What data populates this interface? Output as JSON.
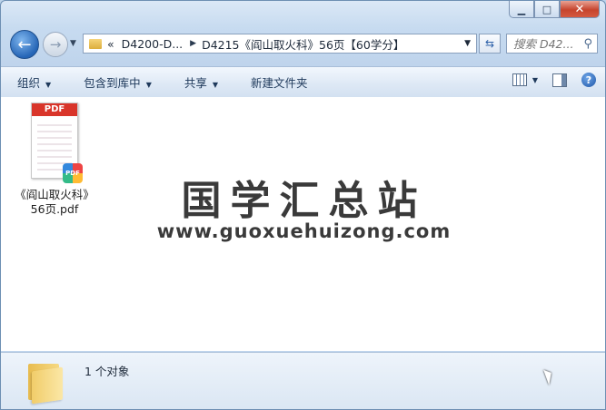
{
  "window": {
    "caption": {
      "minimize": "▁",
      "maximize": "□",
      "close": "✕"
    }
  },
  "nav": {
    "back_icon": "left-arrow-icon",
    "forward_icon": "right-arrow-icon",
    "breadcrumb": [
      {
        "label": "«"
      },
      {
        "label": "D4200-D..."
      },
      {
        "label": "D4215《阎山取火科》56页【60学分】"
      }
    ],
    "search_placeholder": "搜索 D42..."
  },
  "toolbar": {
    "organize": "组织",
    "include_library": "包含到库中",
    "share": "共享",
    "new_folder": "新建文件夹"
  },
  "content": {
    "files": [
      {
        "name_line1": "《阎山取火科》",
        "name_line2": "56页.pdf",
        "type_label": "PDF",
        "badge": "PDF"
      }
    ],
    "watermark": {
      "title": "国学汇总站",
      "url": "www.guoxuehuizong.com"
    }
  },
  "status": {
    "text": "1 个对象"
  }
}
